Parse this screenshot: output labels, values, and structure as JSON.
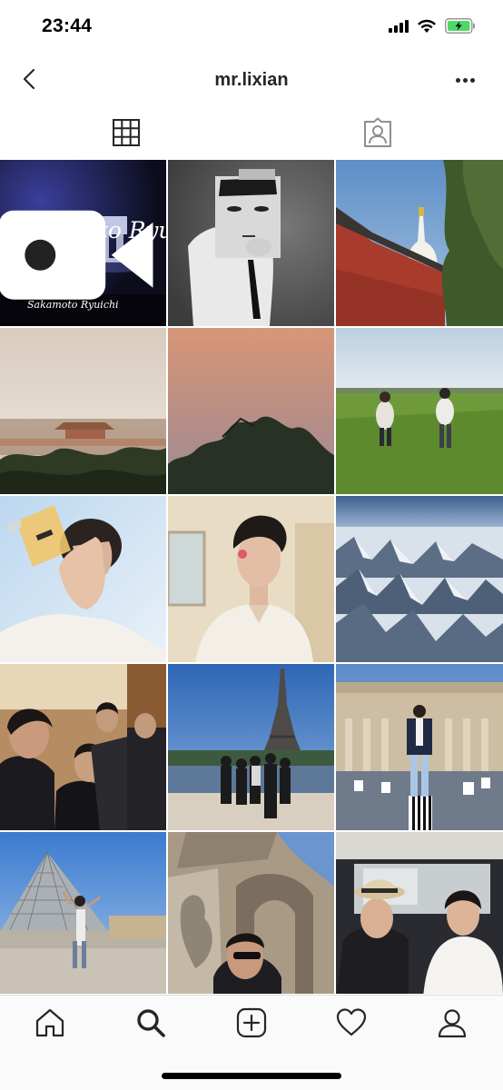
{
  "status_bar": {
    "time": "23:44",
    "icons": [
      "signal-icon",
      "wifi-icon",
      "battery-charging-icon"
    ]
  },
  "header": {
    "title": "mr.lixian",
    "back_icon": "chevron-left-icon",
    "more_icon": "more-horizontal-icon"
  },
  "tabs": [
    {
      "icon": "grid-icon",
      "active": true
    },
    {
      "icon": "tagged-photos-icon",
      "active": false
    }
  ],
  "posts": [
    {
      "subject": "Sakamoto Ryuichi concert screen",
      "video": true,
      "overlay_text": "Sakamoto Ryuichi",
      "overlay_text_2": "Sakamoto Ryuichi"
    },
    {
      "subject": "man holding face mask portrait, black and white"
    },
    {
      "subject": "white stupa and red wall"
    },
    {
      "subject": "Forbidden City skyline in haze"
    },
    {
      "subject": "sunset through trees"
    },
    {
      "subject": "two people walking in grass field"
    },
    {
      "subject": "man holding perfume bottle"
    },
    {
      "subject": "man in white shirt portrait"
    },
    {
      "subject": "snowy mountains aerial view"
    },
    {
      "subject": "group in tuxedos selfie"
    },
    {
      "subject": "group at Eiffel Tower"
    },
    {
      "subject": "man standing on Colonnes de Buren"
    },
    {
      "subject": "man dancing at Louvre pyramid"
    },
    {
      "subject": "man at Arc de Triomphe"
    },
    {
      "subject": "two people in car"
    }
  ],
  "bottom_nav": [
    {
      "icon": "home-icon"
    },
    {
      "icon": "search-icon"
    },
    {
      "icon": "add-post-icon"
    },
    {
      "icon": "heart-icon"
    },
    {
      "icon": "profile-icon"
    }
  ],
  "colors": {
    "text": "#262626",
    "divider": "#dbdbdb",
    "battery_green": "#4cd964"
  }
}
